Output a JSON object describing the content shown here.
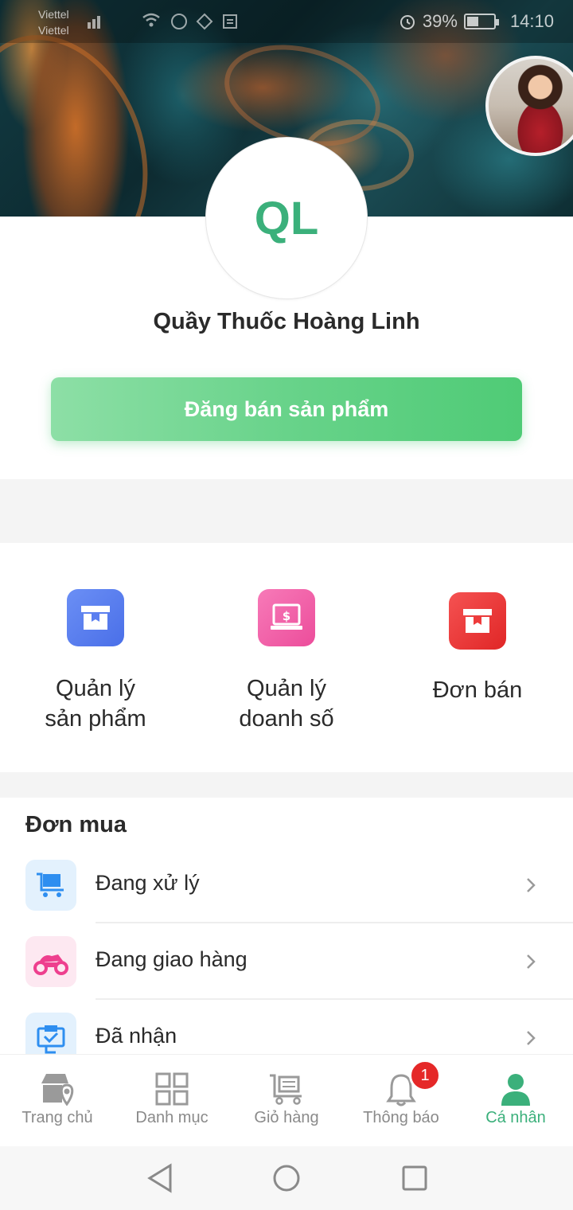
{
  "status_bar": {
    "carrier_1": "Viettel",
    "carrier_2": "Viettel",
    "battery_percent": "39%",
    "time": "14:10"
  },
  "profile": {
    "avatar_initials": "QL",
    "shop_name": "Quầy Thuốc Hoàng Linh",
    "post_button_label": "Đăng bán sản phẩm"
  },
  "shortcuts": [
    {
      "label_line1": "Quản lý",
      "label_line2": "sản phẩm",
      "icon": "box-icon",
      "color": "#5b7ff0"
    },
    {
      "label_line1": "Quản lý",
      "label_line2": "doanh số",
      "icon": "laptop-dollar-icon",
      "color": "#f05aa8"
    },
    {
      "label_line1": "Đơn bán",
      "label_line2": "",
      "icon": "box-icon",
      "color": "#ee3b3b"
    }
  ],
  "orders": {
    "title": "Đơn mua",
    "items": [
      {
        "label": "Đang xử lý",
        "icon": "cart-icon",
        "color": "#2e8ef0"
      },
      {
        "label": "Đang giao hàng",
        "icon": "motorbike-icon",
        "color": "#ee3f8e"
      },
      {
        "label": "Đã nhận",
        "icon": "delivered-icon",
        "color": "#2e8ef0"
      }
    ]
  },
  "bottom_nav": {
    "items": [
      {
        "label": "Trang chủ",
        "icon": "store-location-icon"
      },
      {
        "label": "Danh mục",
        "icon": "grid-icon"
      },
      {
        "label": "Giỏ hàng",
        "icon": "cart-outline-icon"
      },
      {
        "label": "Thông báo",
        "icon": "bell-icon",
        "badge": "1"
      },
      {
        "label": "Cá nhân",
        "icon": "person-icon",
        "active": true
      }
    ],
    "active_color": "#3bb07b"
  }
}
